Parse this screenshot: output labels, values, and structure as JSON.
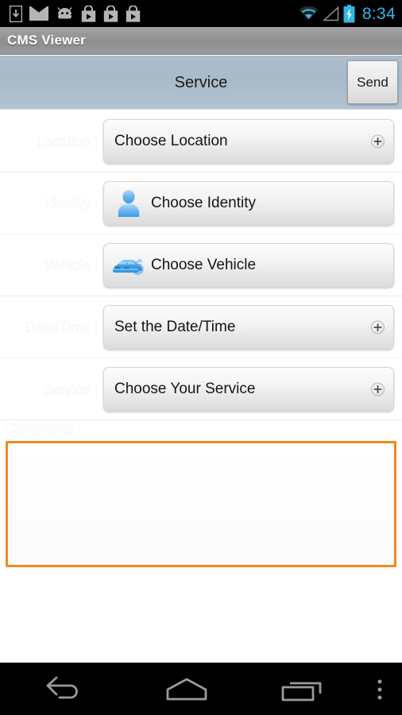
{
  "statusbar": {
    "icons": [
      "download-icon",
      "mail-icon",
      "android-robot-icon",
      "play-store-icon",
      "play-store-icon",
      "play-store-icon"
    ],
    "right_icons": [
      "wifi-icon",
      "signal-icon",
      "battery-charging-icon"
    ],
    "time": "8:34",
    "time_color": "#33b5e5",
    "background": "#000000"
  },
  "titlebar": {
    "app_title": "CMS Viewer",
    "background": "#8e8e8e"
  },
  "subheader": {
    "title": "Service",
    "send_label": "Send",
    "background": "#a9bac9"
  },
  "form": {
    "rows": [
      {
        "label": "Location :",
        "value": "Choose Location",
        "icon": "",
        "has_plus": true
      },
      {
        "label": "Identity :",
        "value": "Choose Identity",
        "icon": "person-icon",
        "has_plus": false
      },
      {
        "label": "Vehicle :",
        "value": "Choose Vehicle",
        "icon": "car-icon",
        "has_plus": false
      },
      {
        "label": "Date/Time :",
        "value": "Set the Date/Time",
        "icon": "",
        "has_plus": true
      },
      {
        "label": "Service :",
        "value": "Choose Your Service",
        "icon": "",
        "has_plus": true
      }
    ]
  },
  "comments": {
    "label": "Comments :",
    "value": "",
    "placeholder": "",
    "focus_border_color": "#f08a1e"
  },
  "navbar": {
    "buttons": [
      "back-icon",
      "home-icon",
      "recent-apps-icon",
      "overflow-menu-icon"
    ],
    "background": "#000000"
  }
}
